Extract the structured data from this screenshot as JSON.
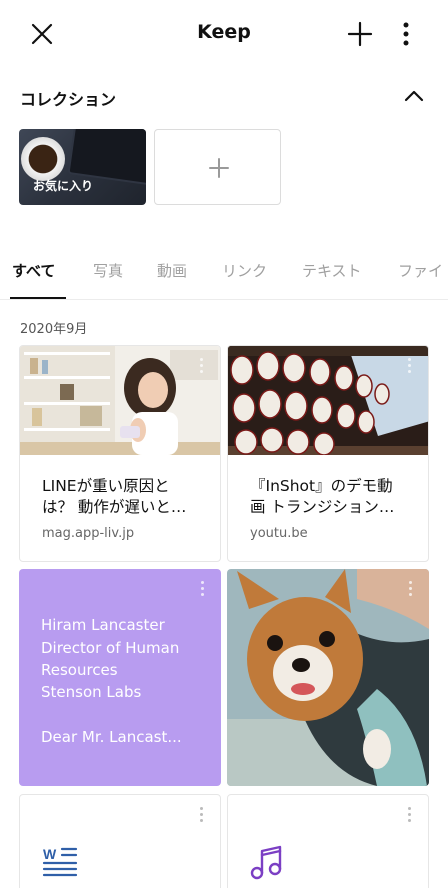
{
  "header": {
    "title": "Keep"
  },
  "collection": {
    "title": "コレクション",
    "favorites_label": "お気に入り"
  },
  "tabs": [
    {
      "label": "すべて"
    },
    {
      "label": "写真"
    },
    {
      "label": "動画"
    },
    {
      "label": "リンク"
    },
    {
      "label": "テキスト"
    },
    {
      "label": "ファイ"
    }
  ],
  "date_group": "2020年9月",
  "items": {
    "link1": {
      "title_l1": "LINEが重い原因と",
      "title_l2": "は？ 動作が遅いと…",
      "domain": "mag.app-liv.jp"
    },
    "link2": {
      "title_l1": "『InShot』のデモ動",
      "title_l2": "画 トランジション…",
      "domain": "youtu.be"
    },
    "text1": {
      "lines": [
        "Hiram Lancaster",
        "Director of Human",
        "Resources",
        "Stenson Labs",
        "",
        "Dear Mr. Lancast..."
      ]
    }
  },
  "colors": {
    "accent_text_card": "#b89cf0",
    "file_icon": "#2f5fa8",
    "music_icon": "#7b3fc4"
  },
  "icons": [
    "close-icon",
    "plus-icon",
    "more-vertical-icon",
    "chevron-up-icon",
    "document-icon",
    "music-note-icon"
  ]
}
